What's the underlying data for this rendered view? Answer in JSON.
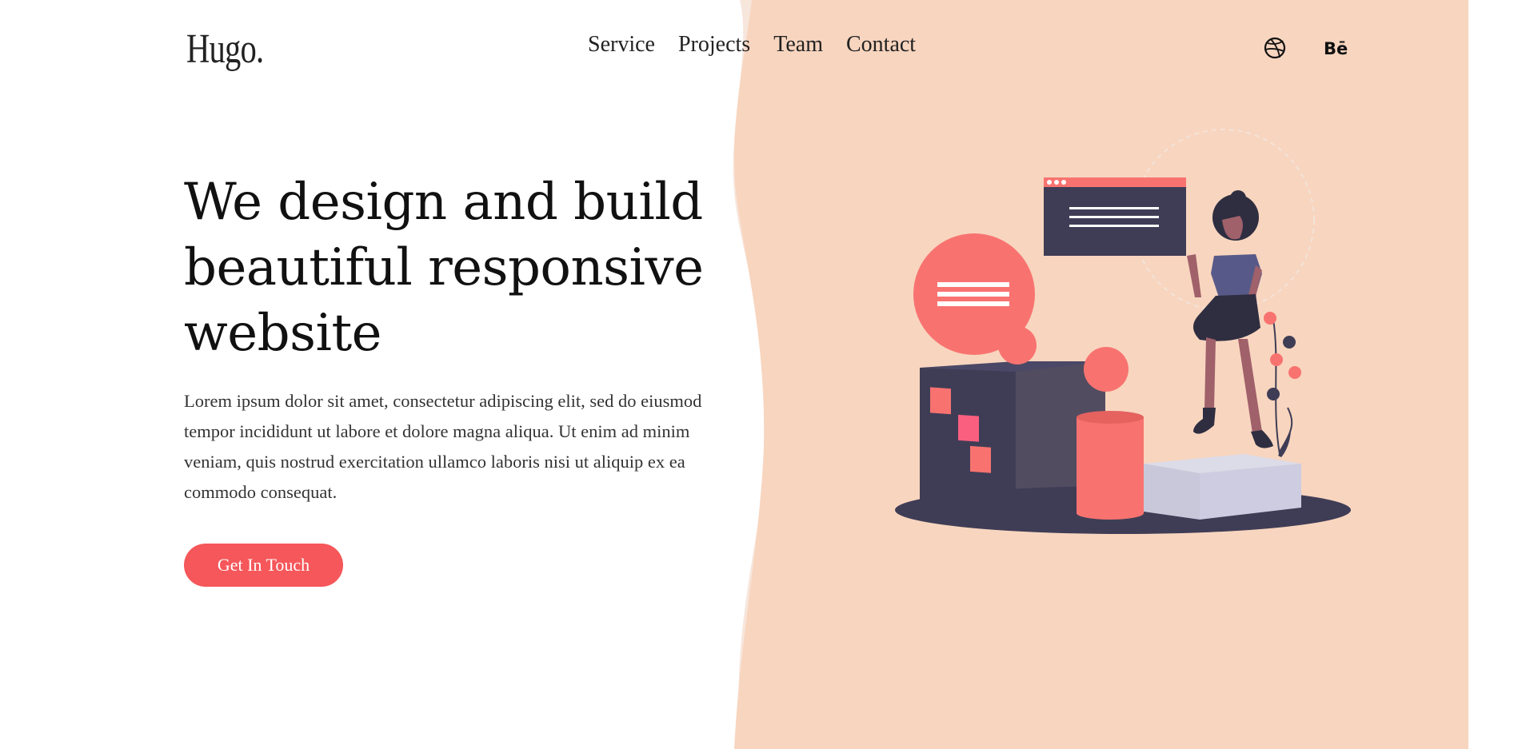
{
  "brand": {
    "logo_text": "Hugo."
  },
  "nav": {
    "items": [
      {
        "label": "Service"
      },
      {
        "label": "Projects"
      },
      {
        "label": "Team"
      },
      {
        "label": "Contact"
      }
    ]
  },
  "social": {
    "dribbble_icon": "dribbble-icon",
    "behance_label": "Bē"
  },
  "hero": {
    "title": "We design and build beautiful responsive website",
    "body": "Lorem ipsum dolor sit amet, consectetur adipiscing elit, sed do eiusmod tempor incididunt ut labore et dolore magna aliqua. Ut enim ad minim veniam, quis nostrud exercitation ullamco laboris nisi ut aliquip ex ea commodo consequat.",
    "cta_label": "Get In Touch"
  },
  "colors": {
    "accent": "#f5575a",
    "peach_bg": "#f8d5bf",
    "peach_light": "#f7e6dc",
    "dark": "#3f3d56",
    "coral": "#f87370"
  }
}
